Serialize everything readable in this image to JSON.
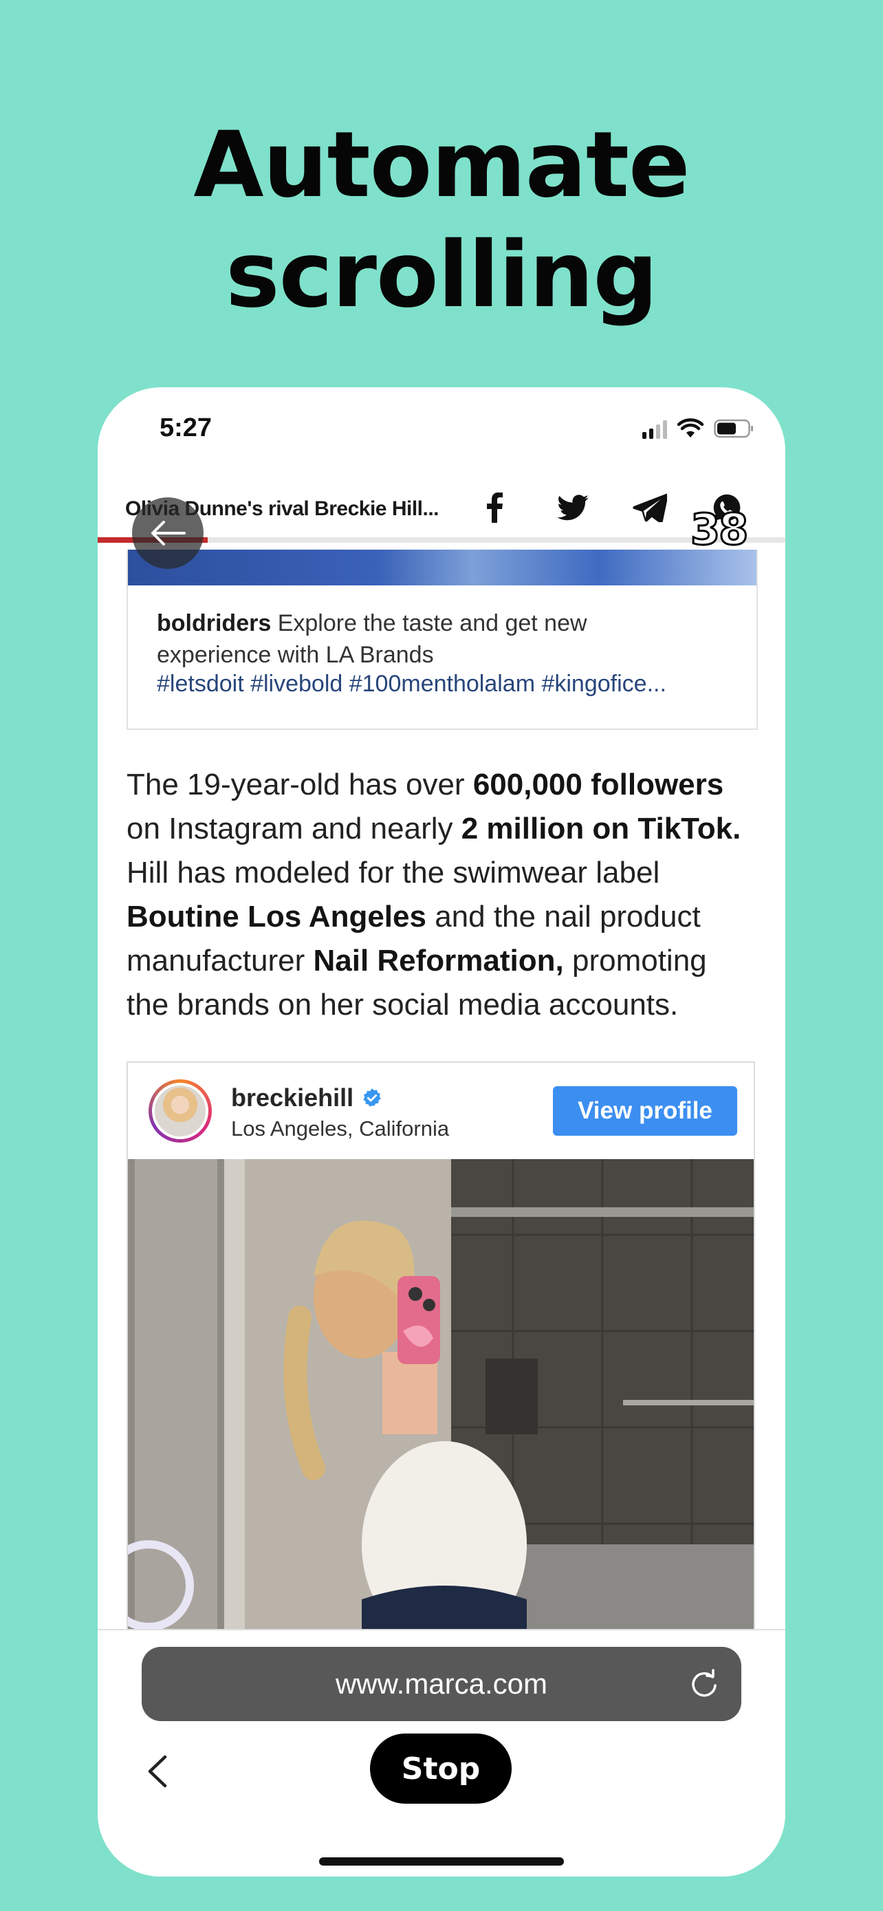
{
  "promo": {
    "headline_line1": "Automate",
    "headline_line2": "scrolling"
  },
  "status_bar": {
    "time": "5:27"
  },
  "article_bar": {
    "title": "Olivia Dunne's rival Breckie Hill...",
    "share_icons": [
      "facebook-icon",
      "twitter-icon",
      "telegram-icon",
      "whatsapp-icon"
    ],
    "progress_fraction": 0.16,
    "progress_color": "#c42b2b"
  },
  "scroll_counter": "38",
  "embedded_post": {
    "username": "boldriders",
    "caption_line1": "Explore the taste and get new",
    "caption_line2": "experience with LA Brands",
    "hashtags": "#letsdoit #livebold #100mentholalam #kingofice..."
  },
  "paragraph": {
    "p1": "The 19-year-old has over ",
    "b1": "600,000 followers",
    "p2": "on Instagram and nearly ",
    "b2": "2 million on TikTok.",
    "p3": "Hill has modeled for the swimwear label",
    "b3": "Boutine Los Angeles",
    "p4": " and the nail product",
    "p5": "manufacturer ",
    "b4": "Nail Reformation,",
    "p6": " promoting",
    "p7": "the brands on her social media accounts."
  },
  "instagram_card": {
    "username": "breckiehill",
    "location": "Los Angeles, California",
    "view_profile_label": "View profile",
    "button_color": "#3c8ff0"
  },
  "browser": {
    "url": "www.marca.com",
    "stop_label": "Stop"
  },
  "colors": {
    "background": "#7fe1cb",
    "headline": "#060606"
  }
}
